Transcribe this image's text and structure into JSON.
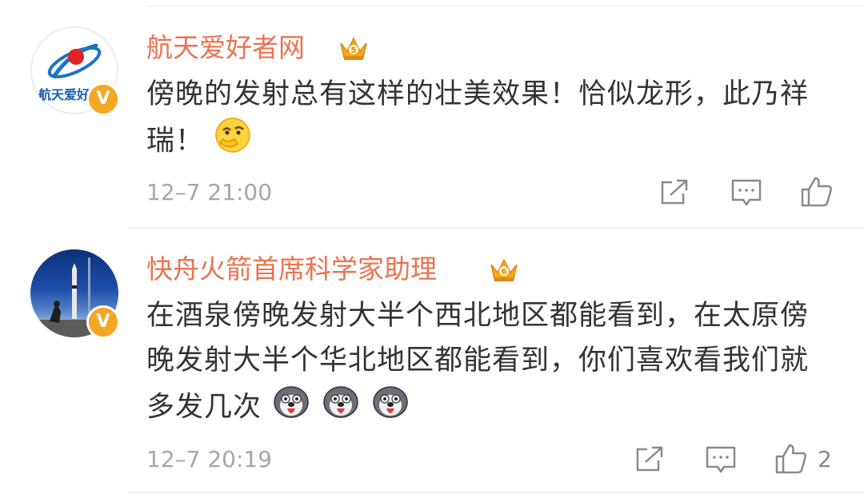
{
  "comments": [
    {
      "avatar_text": "航天爱好者",
      "username": "航天爱好者网",
      "crown_level": "5",
      "text": "傍晚的发射总有这样的壮美效果！恰似龙形，此乃祥瑞！",
      "emoji_names": [
        "thinking-face-emoji"
      ],
      "timestamp": "12–7 21:00",
      "like_count": ""
    },
    {
      "username": "快舟火箭首席科学家助理",
      "crown_level": "6",
      "text": "在酒泉傍晚发射大半个西北地区都能看到，在太原傍晚发射大半个华北地区都能看到，你们喜欢看我们就多发几次",
      "emoji_names": [
        "husky-dog-emoji",
        "husky-dog-emoji",
        "husky-dog-emoji"
      ],
      "timestamp": "12–7 20:19",
      "like_count": "2"
    }
  ],
  "colors": {
    "username": "#eb7350",
    "text": "#333333",
    "meta": "#a6a6a6",
    "verified": "#f5a623",
    "crown": "#f5a623"
  }
}
